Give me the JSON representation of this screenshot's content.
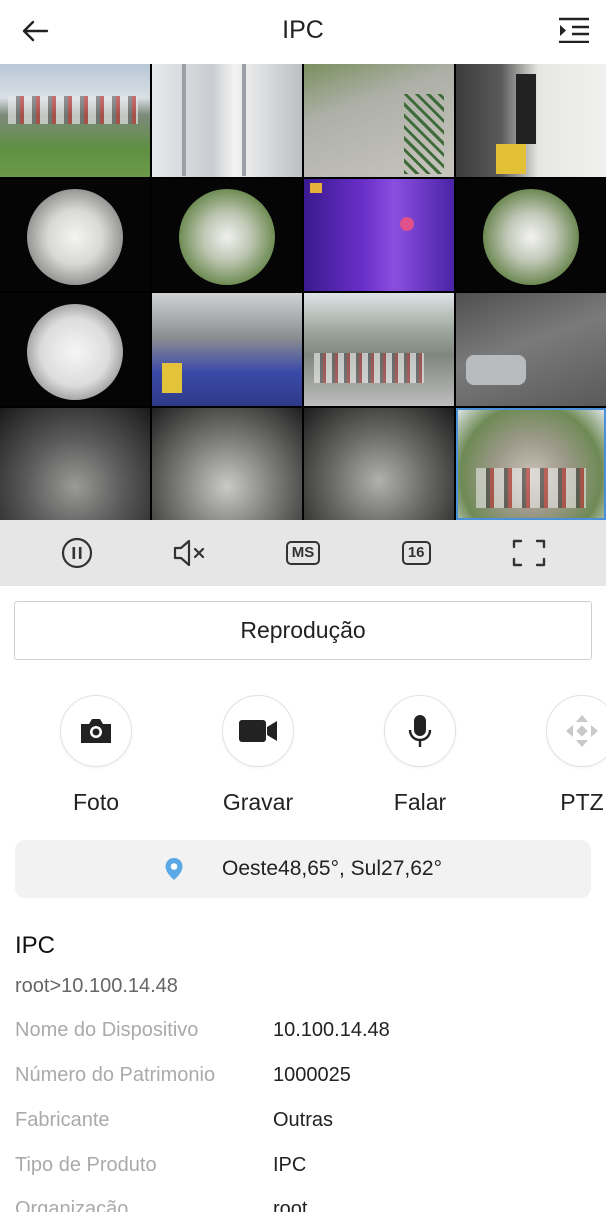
{
  "header": {
    "title": "IPC"
  },
  "camera_grid": {
    "layout": "4x4",
    "cells": [
      {
        "timestamp": ""
      },
      {
        "timestamp": ""
      },
      {
        "timestamp": ""
      },
      {
        "timestamp": ""
      },
      {
        "timestamp": ""
      },
      {
        "timestamp": ""
      },
      {
        "timestamp": ""
      },
      {
        "timestamp": ""
      },
      {
        "timestamp": ""
      },
      {
        "timestamp": ""
      },
      {
        "timestamp": ""
      },
      {
        "timestamp": ""
      },
      {
        "timestamp": ""
      },
      {
        "timestamp": ""
      },
      {
        "timestamp": ""
      },
      {
        "timestamp": ""
      }
    ],
    "selected_index": 15
  },
  "toolbar": {
    "pause_icon": "pause-circle-icon",
    "mute_icon": "speaker-muted-icon",
    "stream_label": "MS",
    "split_count": "16",
    "fullscreen_icon": "fullscreen-icon"
  },
  "playback_button": {
    "label": "Reprodução"
  },
  "actions": [
    {
      "label": "Foto",
      "icon": "camera-icon"
    },
    {
      "label": "Gravar",
      "icon": "video-camera-icon"
    },
    {
      "label": "Falar",
      "icon": "microphone-icon"
    },
    {
      "label": "PTZ",
      "icon": "ptz-arrows-icon"
    }
  ],
  "location": {
    "text": "Oeste48,65°,  Sul27,62°",
    "pin_color": "#5aa9e6"
  },
  "device": {
    "title": "IPC",
    "path": "root>10.100.14.48",
    "fields": [
      {
        "key": "Nome do Dispositivo",
        "value": "10.100.14.48"
      },
      {
        "key": "Número do Patrimonio",
        "value": "1000025"
      },
      {
        "key": "Fabricante",
        "value": "Outras"
      },
      {
        "key": "Tipo de Produto",
        "value": "IPC"
      },
      {
        "key": "Organização",
        "value": "root"
      }
    ]
  }
}
